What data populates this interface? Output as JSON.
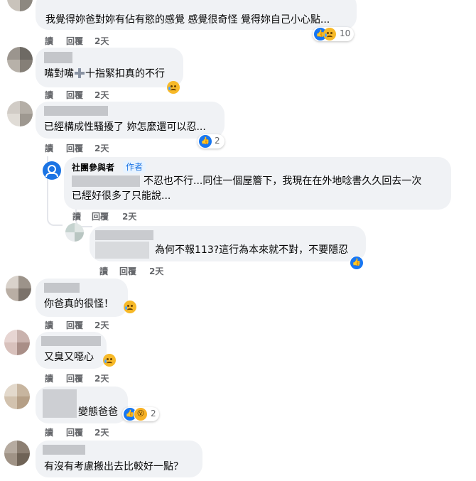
{
  "actions": {
    "read": "讀",
    "reply": "回覆"
  },
  "comments": [
    {
      "text": "我覺得妳爸對妳有佔有慾的感覺 感覺很奇怪 覺得妳自己小心點...",
      "time": "2天",
      "reaction_count": "10"
    },
    {
      "text_before": "嘴對嘴",
      "text_after": "十指緊扣真的不行",
      "time": "2天"
    },
    {
      "text": "已經構成性騷擾了 妳怎麼還可以忍...",
      "time": "2天",
      "reaction_count": "2"
    },
    {
      "author": "社團參與者",
      "author_badge": "作者",
      "line1": "不忍也不行...同住一個屋簷下，我現在在外地唸書久久回去一次",
      "line2": "已經好很多了只能說...",
      "time": "2天"
    },
    {
      "text": "為何不報113?這行為本來就不對，不要隱忍",
      "time": "2天"
    },
    {
      "text": "你爸真的很怪！",
      "time": "2天"
    },
    {
      "text": "又臭又噁心",
      "time": "2天"
    },
    {
      "text": "變態爸爸",
      "time": "2天",
      "reaction_count": "2"
    },
    {
      "text": "有沒有考慮搬出去比較好一點？"
    }
  ]
}
